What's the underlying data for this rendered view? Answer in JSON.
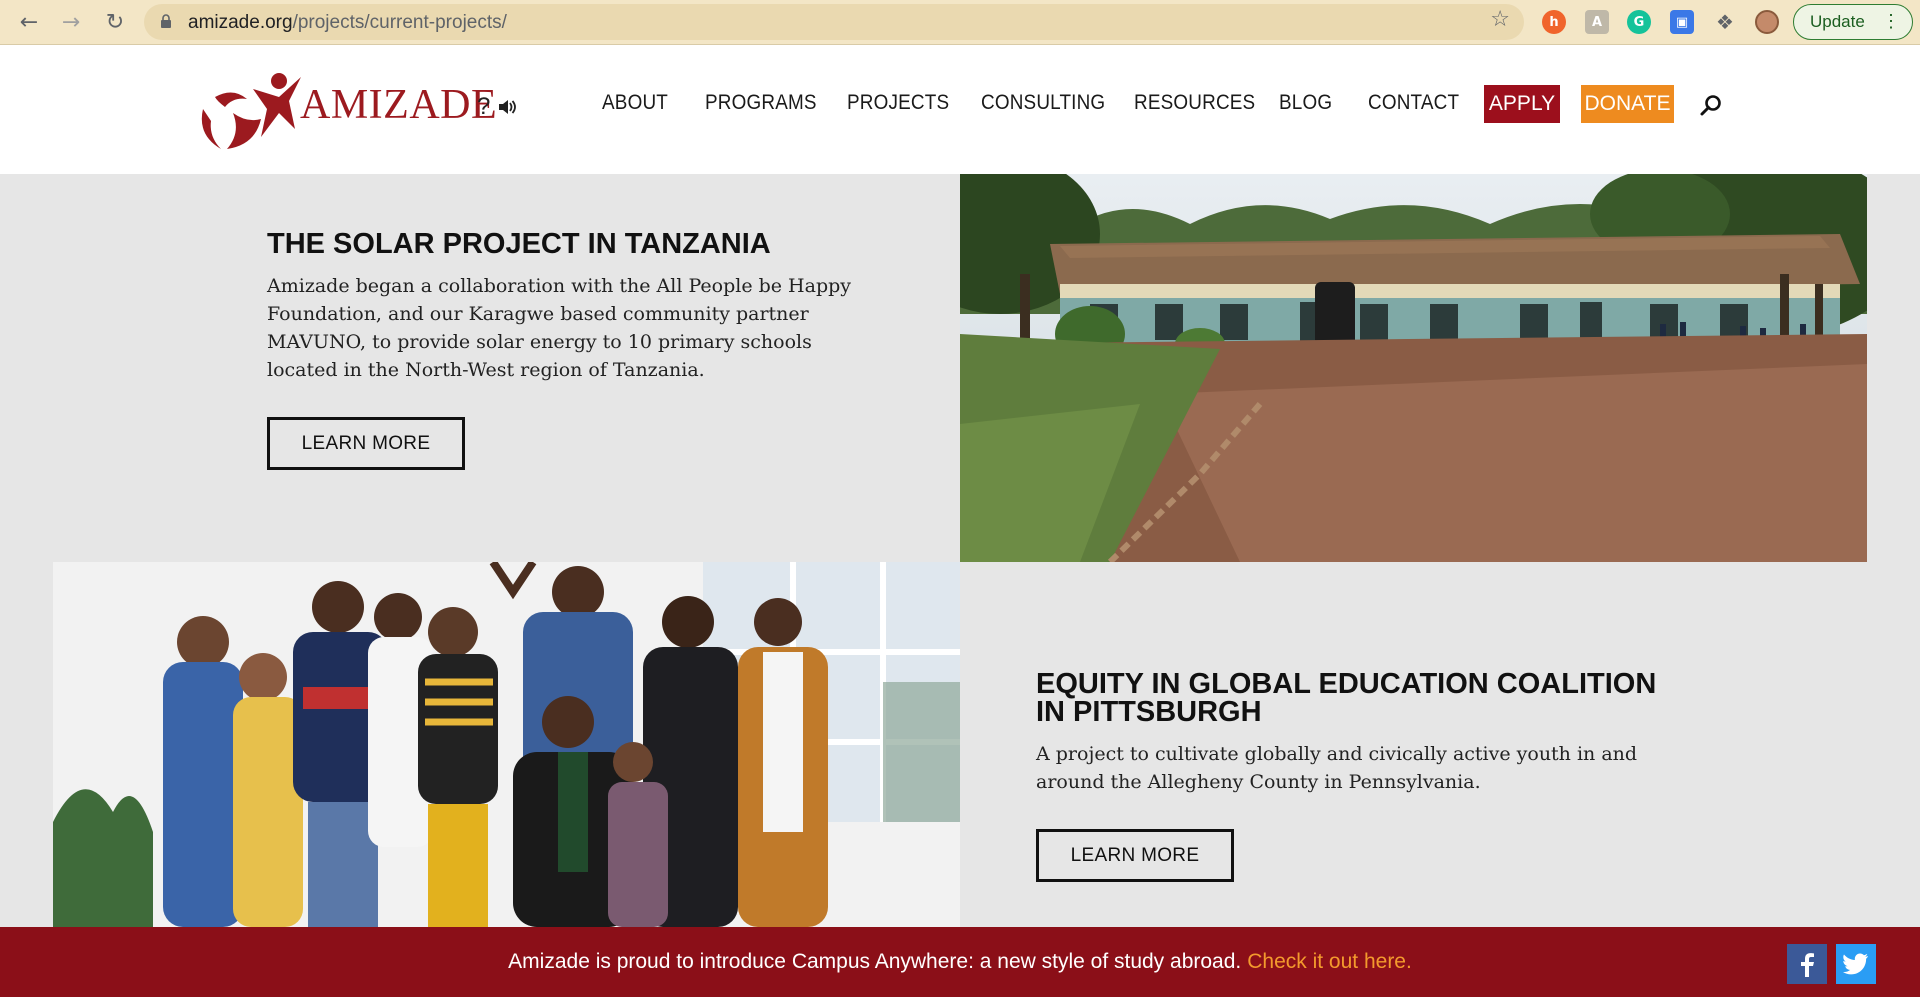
{
  "browser": {
    "url_host": "amizade.org",
    "url_path": "/projects/current-projects/",
    "update_label": "Update"
  },
  "site": {
    "logo_text": "AMIZADE",
    "logo_extra": "?",
    "nav": [
      {
        "label": "ABOUT"
      },
      {
        "label": "PROGRAMS"
      },
      {
        "label": "PROJECTS"
      },
      {
        "label": "CONSULTING"
      },
      {
        "label": "RESOURCES"
      },
      {
        "label": "BLOG"
      },
      {
        "label": "CONTACT"
      }
    ],
    "apply_label": "APPLY",
    "donate_label": "DONATE"
  },
  "projects": [
    {
      "title": "THE SOLAR PROJECT IN TANZANIA",
      "description": "Amizade began a collaboration with the All People be Happy Foundation, and our Karagwe based community partner MAVUNO, to provide solar energy to 10 primary schools located in the North-West region of Tanzania.",
      "button": "LEARN MORE"
    },
    {
      "title": "EQUITY IN GLOBAL EDUCATION COALITION IN PITTSBURGH",
      "description": "A project to cultivate globally and civically active youth in and around the Allegheny County in Pennsylvania.",
      "button": "LEARN MORE"
    }
  ],
  "announcement": {
    "text": "Amizade is proud to introduce Campus Anywhere: a new style of study abroad.",
    "link": "Check it out here."
  },
  "colors": {
    "brand_red": "#9c1a1f",
    "apply_bg": "#9c0f1c",
    "donate_bg": "#ee8b1f",
    "announce_bg": "#8b0f18",
    "link_orange": "#f39a2d",
    "section_bg": "#e6e6e6"
  }
}
